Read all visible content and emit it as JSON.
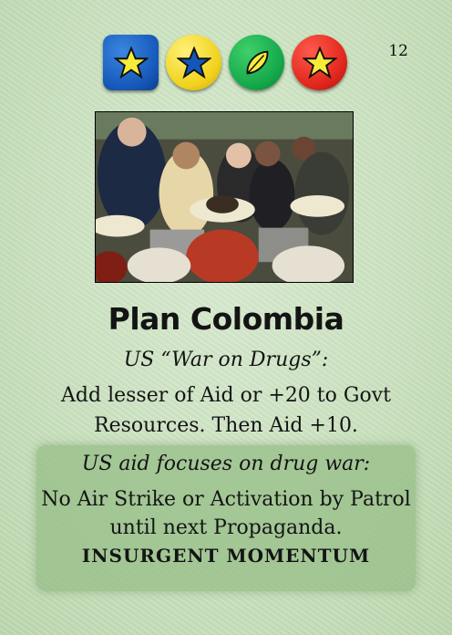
{
  "card": {
    "number": "12",
    "title": "Plan Colombia",
    "event_heading": "US “War on Drugs”:",
    "event_text": "Add lesser of Aid or +20 to Govt Resources. Then Aid +10.",
    "shaded_heading": "US aid focuses on drug war:",
    "shaded_text": "No Air Strike or Activation by Patrol until next Propaganda.",
    "momentum_label": "INSURGENT MOMENTUM"
  },
  "faction_order": [
    {
      "icon": "star-icon",
      "color": "#1557b8",
      "shape": "square"
    },
    {
      "icon": "star-icon",
      "color": "#f1d21b",
      "shape": "circle"
    },
    {
      "icon": "leaf-icon",
      "color": "#15a84a",
      "shape": "circle"
    },
    {
      "icon": "star-icon",
      "color": "#e0261c",
      "shape": "circle"
    }
  ]
}
